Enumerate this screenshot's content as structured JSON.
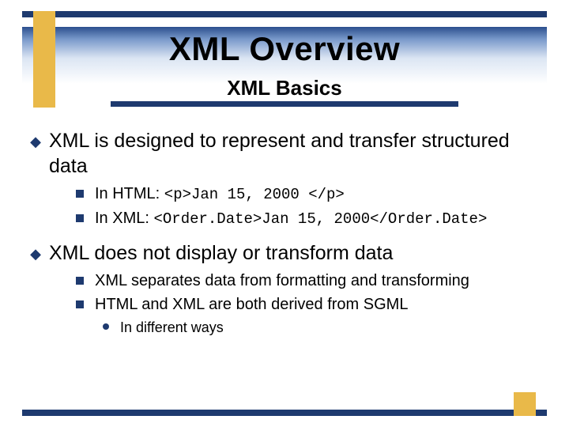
{
  "slide": {
    "title": "XML Overview",
    "subtitle": "XML Basics"
  },
  "bullets": {
    "b1": {
      "text": "XML is designed to represent and transfer structured data",
      "sub": {
        "s1_prefix": "In HTML: ",
        "s1_code": "<p>Jan 15, 2000 </p>",
        "s2_prefix": "In XML: ",
        "s2_code": "<Order.Date>Jan 15, 2000</Order.Date>"
      }
    },
    "b2": {
      "text": "XML does not display or transform data",
      "sub": {
        "s1": "XML separates data from formatting and transforming",
        "s2": "HTML and XML are both derived from SGML",
        "s2sub": {
          "t1": "In different ways"
        }
      }
    }
  }
}
